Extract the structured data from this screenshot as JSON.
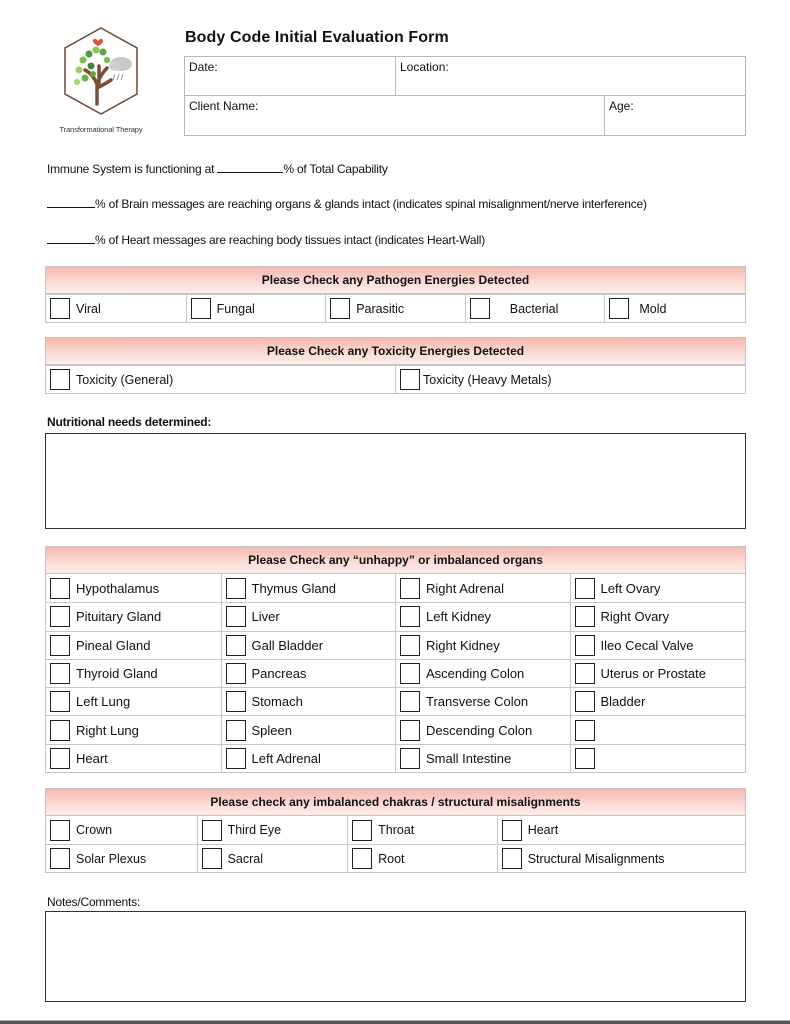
{
  "logo": {
    "icon": "tree-cloud-hexagon-logo",
    "caption": "Transformational Therapy"
  },
  "header": {
    "title": "Body Code Initial Evaluation Form",
    "fields": {
      "date_label": "Date:",
      "date_value": "",
      "location_label": "Location:",
      "location_value": "",
      "client_name_label": "Client Name:",
      "client_name_value": "",
      "age_label": "Age:",
      "age_value": ""
    }
  },
  "percentages": {
    "immune": {
      "prefix": "Immune System is functioning at",
      "value": "",
      "suffix": "% of Total Capability"
    },
    "brain": {
      "value": "",
      "suffix": "% of Brain messages are reaching organs & glands intact (indicates spinal misalignment/nerve interference)"
    },
    "heart": {
      "value": "",
      "suffix": "% of Heart messages are reaching body tissues intact (indicates Heart-Wall)"
    }
  },
  "colors": {
    "section_header_top": "#f5b8ae",
    "section_header_bottom": "#fdeeea",
    "border": "#c4c4c4"
  },
  "pathogen": {
    "header": "Please Check any Pathogen Energies Detected",
    "items": [
      {
        "label": "Viral",
        "checked": false
      },
      {
        "label": "Fungal",
        "checked": false
      },
      {
        "label": "Parasitic",
        "checked": false
      },
      {
        "label": "Bacterial",
        "checked": false
      },
      {
        "label": "Mold",
        "checked": false
      }
    ]
  },
  "toxicity": {
    "header": "Please Check any Toxicity Energies Detected",
    "items": [
      {
        "label": "Toxicity (General)",
        "checked": false
      },
      {
        "label": "Toxicity (Heavy Metals)",
        "checked": false
      }
    ]
  },
  "nutritional": {
    "label": "Nutritional needs determined:",
    "value": ""
  },
  "organs": {
    "header": "Please Check any “unhappy” or imbalanced organs",
    "rows": [
      [
        "Hypothalamus",
        "Thymus Gland",
        "Right Adrenal",
        "Left Ovary"
      ],
      [
        "Pituitary Gland",
        "Liver",
        "Left Kidney",
        "Right Ovary"
      ],
      [
        "Pineal Gland",
        "Gall Bladder",
        "Right Kidney",
        "Ileo Cecal Valve"
      ],
      [
        "Thyroid Gland",
        "Pancreas",
        "Ascending Colon",
        "Uterus or Prostate"
      ],
      [
        "Left Lung",
        "Stomach",
        "Transverse Colon",
        "Bladder"
      ],
      [
        "Right Lung",
        "Spleen",
        "Descending Colon",
        ""
      ],
      [
        "Heart",
        "Left Adrenal",
        "Small Intestine",
        ""
      ]
    ]
  },
  "chakras": {
    "header": "Please check any imbalanced chakras / structural misalignments",
    "rows": [
      [
        "Crown",
        "Third Eye",
        "Throat",
        "Heart"
      ],
      [
        "Solar Plexus",
        "Sacral",
        "Root",
        "Structural Misalignments"
      ]
    ]
  },
  "notes": {
    "label": "Notes/Comments:",
    "value": ""
  }
}
